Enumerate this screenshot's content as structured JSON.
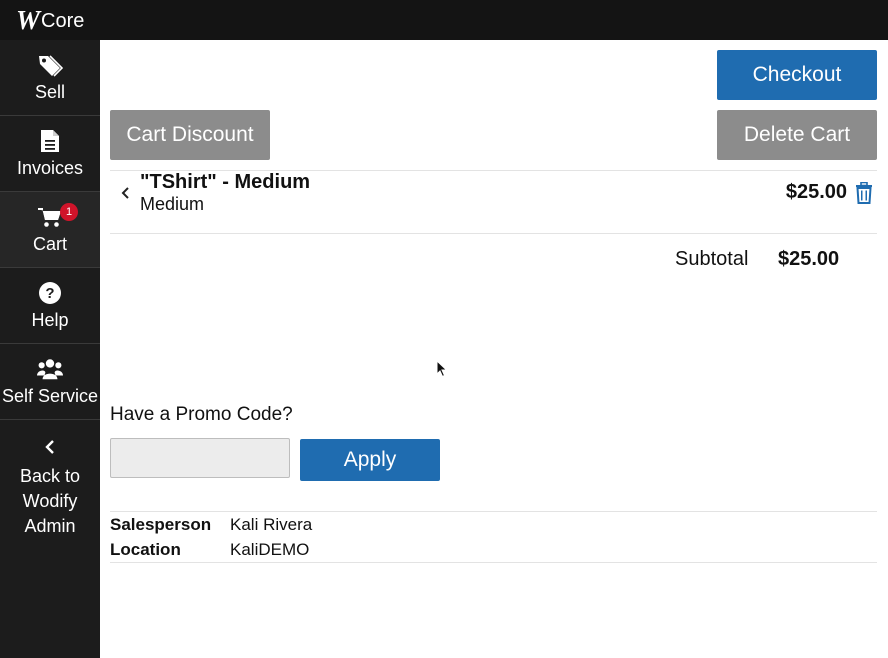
{
  "app": {
    "brand_logo": "W",
    "brand_name": "Core"
  },
  "sidebar": {
    "items": [
      {
        "label": "Sell",
        "icon": "tag-icon"
      },
      {
        "label": "Invoices",
        "icon": "document-icon"
      },
      {
        "label": "Cart",
        "icon": "cart-icon",
        "badge": "1"
      },
      {
        "label": "Help",
        "icon": "question-icon"
      },
      {
        "label": "Self Service",
        "icon": "users-icon"
      },
      {
        "label": "Back to Wodify Admin",
        "icon": "chevron-left-icon"
      }
    ]
  },
  "toolbar": {
    "checkout_label": "Checkout",
    "cart_discount_label": "Cart Discount",
    "delete_cart_label": "Delete Cart"
  },
  "cart": {
    "items": [
      {
        "name": "\"TShirt\" - Medium",
        "variant": "Medium",
        "price": "$25.00"
      }
    ],
    "subtotal_label": "Subtotal",
    "subtotal_value": "$25.00"
  },
  "promo": {
    "label": "Have a Promo Code?",
    "input_value": "",
    "apply_label": "Apply"
  },
  "info": {
    "salesperson_label": "Salesperson",
    "salesperson_value": "Kali Rivera",
    "location_label": "Location",
    "location_value": "KaliDEMO"
  },
  "colors": {
    "primary": "#1f6cb0",
    "secondary": "#8c8c8c",
    "sidebar": "#1c1c1c",
    "topbar": "#141414",
    "badge": "#d0142a"
  }
}
